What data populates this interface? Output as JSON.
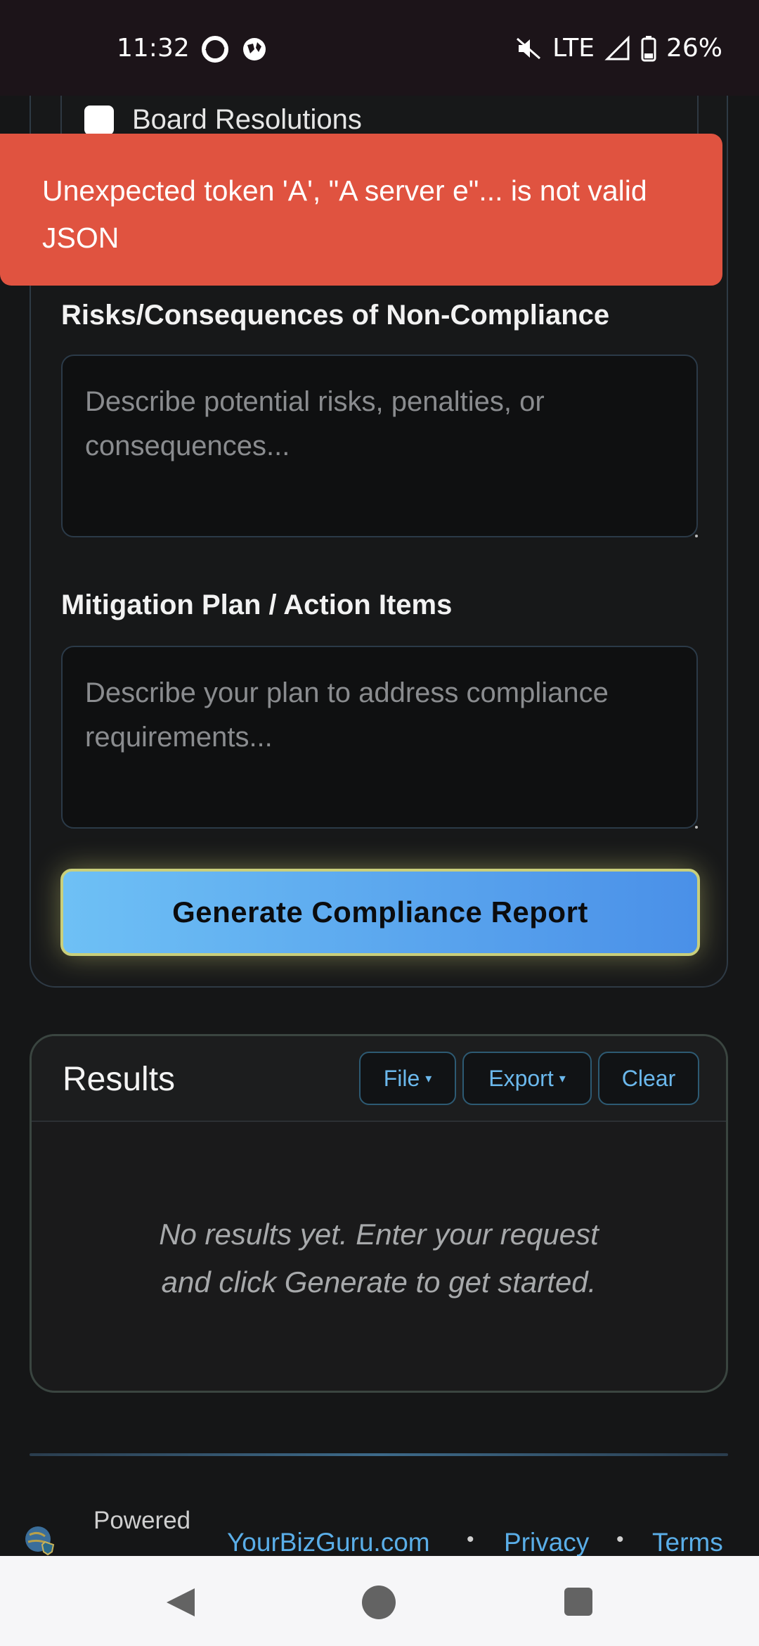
{
  "status_bar": {
    "time": "11:32",
    "network": "LTE",
    "battery": "26%"
  },
  "checklist": {
    "item_label": "Board Resolutions"
  },
  "toast": {
    "message": "Unexpected token 'A', \"A server e\"... is not valid JSON",
    "color": "#e05340"
  },
  "form": {
    "risks_label": "Risks/Consequences of Non-Compliance",
    "risks_placeholder": "Describe potential risks, penalties, or consequences...",
    "mitigation_label": "Mitigation Plan / Action Items",
    "mitigation_placeholder": "Describe your plan to address compliance requirements...",
    "generate_button": "Generate Compliance Report"
  },
  "results": {
    "title": "Results",
    "file_button": "File",
    "export_button": "Export",
    "clear_button": "Clear",
    "empty_message": "No results yet. Enter your request and click Generate to get started."
  },
  "footer": {
    "powered_text": "Powered",
    "site_link": "YourBizGuru.com",
    "privacy_link": "Privacy",
    "terms_link": "Terms",
    "separator": "•"
  },
  "colors": {
    "accent": "#5aaee8",
    "background": "#151617",
    "button_gradient_start": "#6ec0f5",
    "button_gradient_end": "#4a90e8"
  }
}
